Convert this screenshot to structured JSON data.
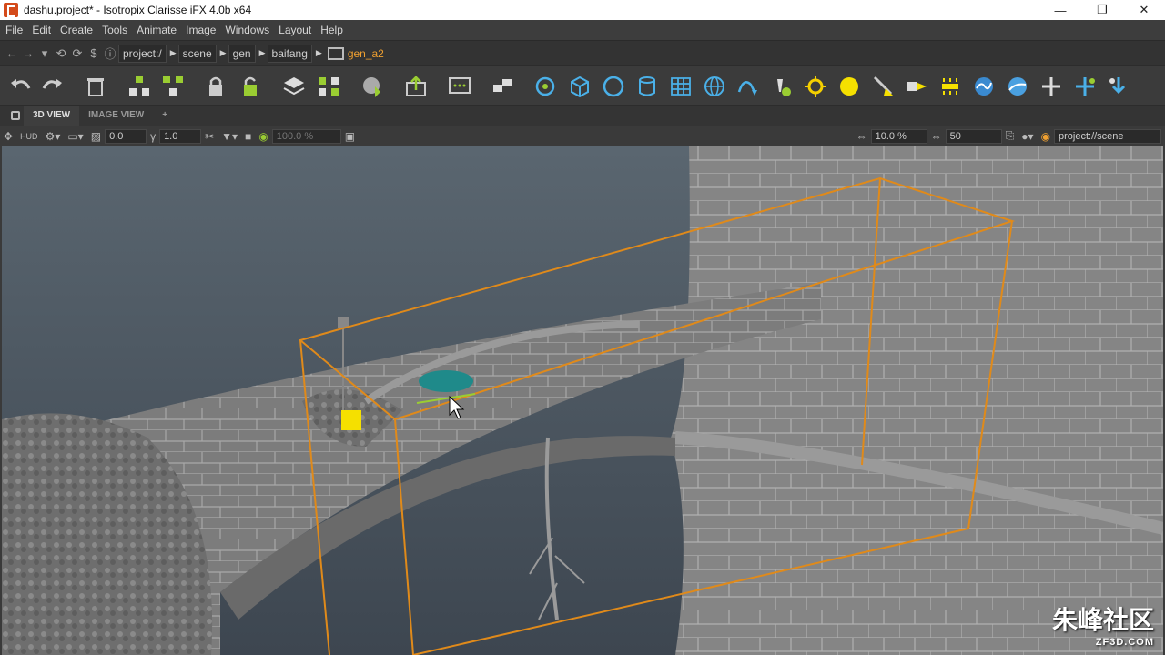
{
  "window": {
    "title": "dashu.project* - Isotropix Clarisse iFX 4.0b x64"
  },
  "menu": {
    "items": [
      "File",
      "Edit",
      "Create",
      "Tools",
      "Animate",
      "Image",
      "Windows",
      "Layout",
      "Help"
    ]
  },
  "path": {
    "segments": [
      "project:/",
      "scene",
      "gen",
      "baifang"
    ],
    "current": "gen_a2"
  },
  "tabs": {
    "view3d": "3D VIEW",
    "image_view": "IMAGE VIEW",
    "add": "+"
  },
  "viewbar": {
    "hud": "HUD",
    "field1": "0.0",
    "field2": "1.0",
    "field3": "100.0 %",
    "zoom": "10.0 %",
    "count": "50",
    "context": "project://scene"
  },
  "colors": {
    "accent": "#f0a030",
    "selection_box": "#e08a1a",
    "background_top": "#5a6670"
  },
  "watermark": {
    "main": "朱峰社区",
    "sub": "ZF3D.COM"
  }
}
